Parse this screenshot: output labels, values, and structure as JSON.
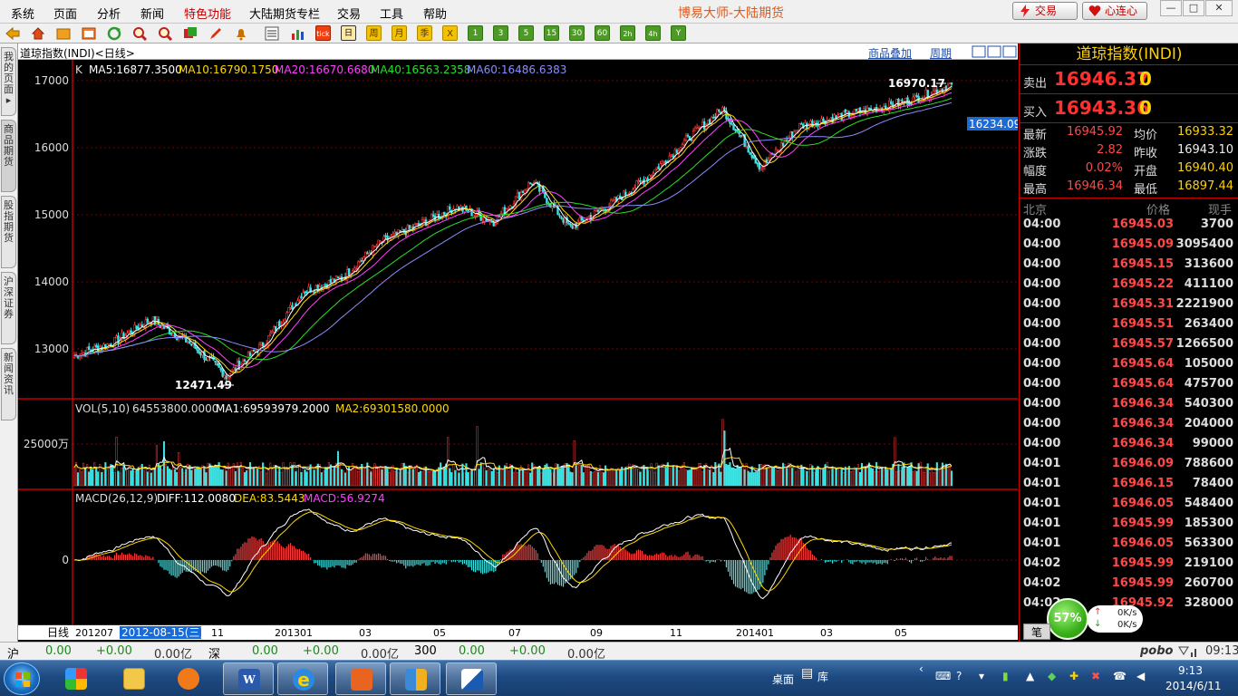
{
  "menu": {
    "items": [
      "系统",
      "页面",
      "分析",
      "新闻",
      "特色功能",
      "大陆期货专栏",
      "交易",
      "工具",
      "帮助"
    ],
    "app_title": "博易大师-大陆期货",
    "trade_button": "交易",
    "xinlian_button": "心连心"
  },
  "toolbar": {
    "period_buttons": [
      "日",
      "周",
      "月",
      "季",
      "X",
      "1",
      "3",
      "5",
      "15",
      "30",
      "60",
      "2h",
      "4h",
      "Y"
    ],
    "active_period": "日"
  },
  "left_tabs": [
    "我的页面",
    "商品期货",
    "股指期货",
    "沪深证券",
    "新闻资讯"
  ],
  "chart_header": {
    "title": "道琼指数(INDI)<日线>",
    "overlay_link": "商品叠加",
    "period_link": "周期"
  },
  "main_panel": {
    "label": "K",
    "ma": [
      {
        "text": "MA5:16877.3500",
        "color": "#ffffff"
      },
      {
        "text": "MA10:16790.1750",
        "color": "#ffd800"
      },
      {
        "text": "MA20:16670.6680",
        "color": "#ff40ff"
      },
      {
        "text": "MA40:16563.2358",
        "color": "#28e028"
      },
      {
        "text": "MA60:16486.6383",
        "color": "#8c8cff"
      }
    ],
    "y_ticks": [
      "17000",
      "16000",
      "15000",
      "14000",
      "13000"
    ],
    "high_label": "16970.17",
    "low_label": "12471.49",
    "cursor_price": "16234.09"
  },
  "volume_panel": {
    "header": {
      "name": "VOL(5,10)",
      "value": "64553800.0000",
      "ma1": "MA1:69593979.2000",
      "ma2": "MA2:69301580.0000"
    },
    "y_tick": "25000万"
  },
  "macd_panel": {
    "header": {
      "name": "MACD(26,12,9)",
      "diff": "DIFF:112.0080",
      "dea": "DEA:83.5443",
      "macd": "MACD:56.9274"
    },
    "zero_tick": "0"
  },
  "x_axis": {
    "period_label": "日线",
    "selected_date": "2012-08-15(三)",
    "labels": [
      "201207",
      "11",
      "201301",
      "03",
      "05",
      "07",
      "09",
      "11",
      "201401",
      "03",
      "05"
    ]
  },
  "chart_data": {
    "type": "candlestick",
    "title": "道琼指数(INDI)<日线>",
    "x_range": [
      "2012-07",
      "2014-06"
    ],
    "ylim": [
      12400,
      17100
    ],
    "series_close_monthly": {
      "x": [
        "2012-07",
        "2012-08",
        "2012-09",
        "2012-10",
        "2012-11",
        "2012-12",
        "2013-01",
        "2013-02",
        "2013-03",
        "2013-04",
        "2013-05",
        "2013-06",
        "2013-07",
        "2013-08",
        "2013-09",
        "2013-10",
        "2013-11",
        "2013-12",
        "2014-01",
        "2014-02",
        "2014-03",
        "2014-04",
        "2014-05",
        "2014-06"
      ],
      "y": [
        12900,
        13090,
        13440,
        13100,
        12600,
        13100,
        13860,
        14050,
        14580,
        14840,
        15120,
        14900,
        15500,
        14810,
        15130,
        15550,
        16090,
        16580,
        15700,
        16320,
        16460,
        16580,
        16720,
        16946
      ]
    },
    "period_high": 16970.17,
    "period_low": 12471.49,
    "indicators": {
      "ma": {
        "MA5": 16877.35,
        "MA10": 16790.175,
        "MA20": 16670.668,
        "MA40": 16563.2358,
        "MA60": 16486.6383
      },
      "volume": {
        "VOL": 64553800,
        "MA1": 69593979.2,
        "MA2": 69301580
      },
      "macd": {
        "DIFF": 112.008,
        "DEA": 83.5443,
        "MACD": 56.9274
      }
    }
  },
  "quote": {
    "title": "道琼指数(INDI)",
    "ask": {
      "label": "卖出",
      "price": "16946.37",
      "vol": "0"
    },
    "bid": {
      "label": "买入",
      "price": "16943.36",
      "vol": "0"
    },
    "stats": [
      {
        "label": "最新",
        "value": "16945.92",
        "color": "red"
      },
      {
        "label": "均价",
        "value": "16933.32",
        "color": "yel"
      },
      {
        "label": "涨跌",
        "value": "2.82",
        "color": "red"
      },
      {
        "label": "昨收",
        "value": "16943.10",
        "color": "wht"
      },
      {
        "label": "幅度",
        "value": "0.02%",
        "color": "red"
      },
      {
        "label": "开盘",
        "value": "16940.40",
        "color": "yel"
      },
      {
        "label": "最高",
        "value": "16946.34",
        "color": "red"
      },
      {
        "label": "最低",
        "value": "16897.44",
        "color": "yel"
      }
    ],
    "tick_headers": [
      "北京",
      "价格",
      "现手"
    ],
    "ticks": [
      {
        "time": "04:00",
        "price": "16945.03",
        "vol": "3700"
      },
      {
        "time": "04:00",
        "price": "16945.09",
        "vol": "3095400"
      },
      {
        "time": "04:00",
        "price": "16945.15",
        "vol": "313600"
      },
      {
        "time": "04:00",
        "price": "16945.22",
        "vol": "411100"
      },
      {
        "time": "04:00",
        "price": "16945.31",
        "vol": "2221900"
      },
      {
        "time": "04:00",
        "price": "16945.51",
        "vol": "263400"
      },
      {
        "time": "04:00",
        "price": "16945.57",
        "vol": "1266500"
      },
      {
        "time": "04:00",
        "price": "16945.64",
        "vol": "105000"
      },
      {
        "time": "04:00",
        "price": "16945.64",
        "vol": "475700"
      },
      {
        "time": "04:00",
        "price": "16946.34",
        "vol": "540300"
      },
      {
        "time": "04:00",
        "price": "16946.34",
        "vol": "204000"
      },
      {
        "time": "04:00",
        "price": "16946.34",
        "vol": "99000"
      },
      {
        "time": "04:01",
        "price": "16946.09",
        "vol": "788600"
      },
      {
        "time": "04:01",
        "price": "16946.15",
        "vol": "78400"
      },
      {
        "time": "04:01",
        "price": "16946.05",
        "vol": "548400"
      },
      {
        "time": "04:01",
        "price": "16945.99",
        "vol": "185300"
      },
      {
        "time": "04:01",
        "price": "16946.05",
        "vol": "563300"
      },
      {
        "time": "04:02",
        "price": "16945.99",
        "vol": "219100"
      },
      {
        "time": "04:02",
        "price": "16945.99",
        "vol": "260700"
      },
      {
        "time": "04:02",
        "price": "16945.92",
        "vol": "328000"
      }
    ],
    "bi_tab": "笔",
    "speed": {
      "percent": "57%",
      "up": "0K/s",
      "down": "0K/s"
    }
  },
  "status_bar": {
    "markets": [
      {
        "name": "沪",
        "v1": "0.00",
        "v2": "+0.00",
        "v3": "0.00亿"
      },
      {
        "name": "深",
        "v1": "0.00",
        "v2": "+0.00",
        "v3": "0.00亿"
      },
      {
        "name": "300",
        "v1": "0.00",
        "v2": "+0.00",
        "v3": "0.00亿"
      }
    ],
    "brand": "pobo",
    "time": "09:13"
  },
  "taskbar": {
    "desktop_label": "桌面",
    "lib_label": "库",
    "clock_time": "9:13",
    "clock_date": "2014/6/11"
  },
  "colors": {
    "up": "#ff3b3b",
    "down": "#39e5e5",
    "grid": "#7a0000",
    "accent": "#ffd000"
  }
}
